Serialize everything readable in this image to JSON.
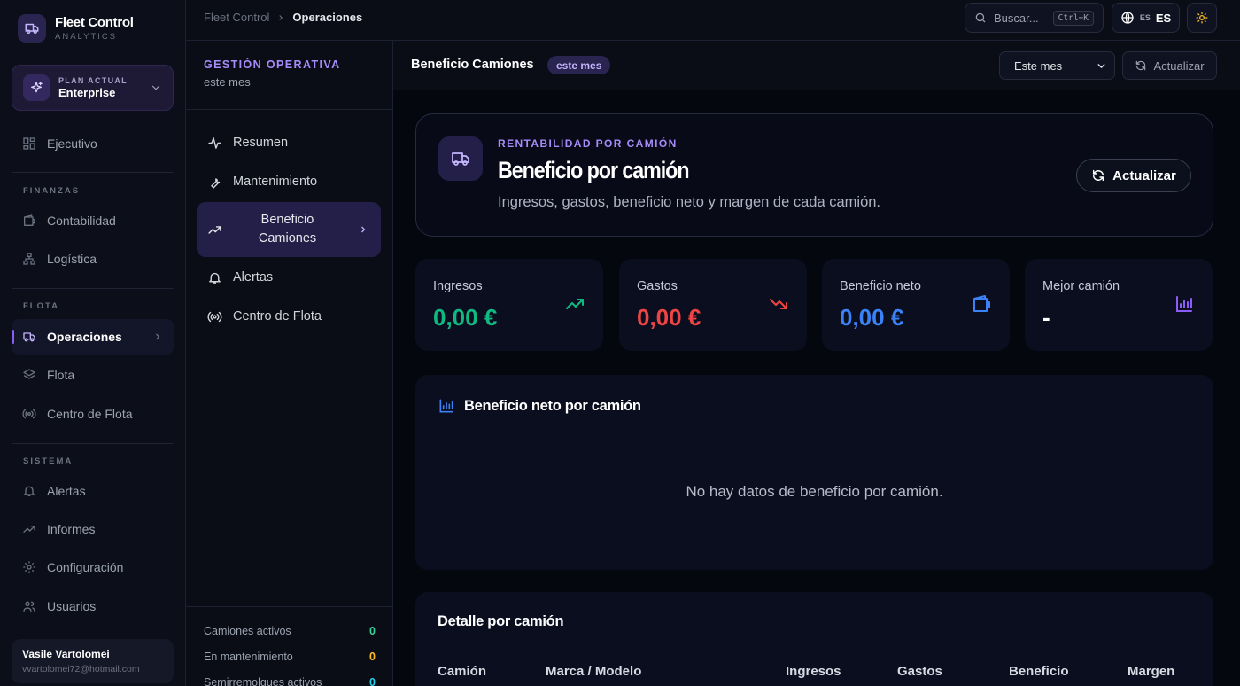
{
  "brand": {
    "title": "Fleet Control",
    "subtitle": "ANALYTICS"
  },
  "plan": {
    "label": "PLAN ACTUAL",
    "value": "Enterprise"
  },
  "sidebar": {
    "top_item": "Ejecutivo",
    "sections": {
      "finanzas": "FINANZAS",
      "flota": "FLOTA",
      "sistema": "SISTEMA"
    },
    "items": {
      "contabilidad": "Contabilidad",
      "logistica": "Logística",
      "operaciones": "Operaciones",
      "flota": "Flota",
      "centro": "Centro de Flota",
      "alertas": "Alertas",
      "informes": "Informes",
      "configuracion": "Configuración",
      "usuarios": "Usuarios"
    }
  },
  "user": {
    "name": "Vasile Vartolomei",
    "email": "vvartolomei72@hotmail.com"
  },
  "topbar": {
    "breadcrumb_root": "Fleet Control",
    "breadcrumb_current": "Operaciones",
    "search_label": "Buscar...",
    "search_shortcut": "Ctrl+K",
    "lang_small": "ES",
    "lang": "ES"
  },
  "subnav": {
    "title": "GESTIÓN OPERATIVA",
    "subtitle": "este mes",
    "items": {
      "resumen": "Resumen",
      "mantenimiento": "Mantenimiento",
      "beneficio": "Beneficio Camiones",
      "alertas": "Alertas",
      "centro": "Centro de Flota"
    },
    "stats": [
      {
        "label": "Camiones activos",
        "value": "0",
        "color": "#34d399"
      },
      {
        "label": "En mantenimiento",
        "value": "0",
        "color": "#fbbf24"
      },
      {
        "label": "Semirremolques activos",
        "value": "0",
        "color": "#22d3ee"
      }
    ]
  },
  "main": {
    "title": "Beneficio Camiones",
    "pill": "este mes",
    "period_select": "Este mes",
    "refresh": "Actualizar"
  },
  "hero": {
    "kicker": "RENTABILIDAD POR CAMIÓN",
    "title": "Beneficio por camión",
    "description": "Ingresos, gastos, beneficio neto y margen de cada camión.",
    "button": "Actualizar"
  },
  "kpis": {
    "ingresos": {
      "label": "Ingresos",
      "value": "0,00 €",
      "color": "#10b981"
    },
    "gastos": {
      "label": "Gastos",
      "value": "0,00 €",
      "color": "#ef4444"
    },
    "neto": {
      "label": "Beneficio neto",
      "value": "0,00 €",
      "color": "#3b82f6"
    },
    "mejor": {
      "label": "Mejor camión",
      "value": "-",
      "color": "#ffffff"
    }
  },
  "chart": {
    "title": "Beneficio neto por camión",
    "empty": "No hay datos de beneficio por camión."
  },
  "detail": {
    "title": "Detalle por camión",
    "columns": {
      "camion": "Camión",
      "marca": "Marca / Modelo",
      "ingresos": "Ingresos",
      "gastos": "Gastos",
      "beneficio": "Beneficio",
      "margen": "Margen"
    }
  },
  "colors": {
    "accent": "#8b5cf6",
    "accent_text": "#a78bfa"
  }
}
